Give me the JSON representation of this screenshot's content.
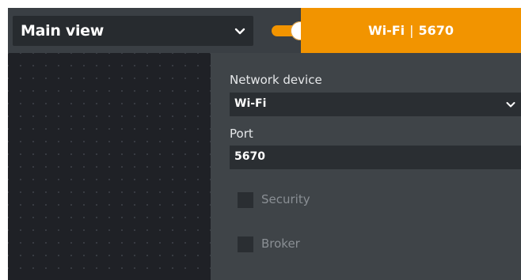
{
  "header": {
    "view_selector": {
      "label": "Main view",
      "icon": "chevron-down-icon"
    },
    "toggle": {
      "state": "on",
      "color": "#f29400"
    },
    "connection_tab": {
      "network": "Wi-Fi",
      "separator": "|",
      "port": "5670",
      "color": "#f29400"
    }
  },
  "form": {
    "network_device": {
      "label": "Network device",
      "value": "Wi-Fi",
      "icon": "chevron-down-icon"
    },
    "port": {
      "label": "Port",
      "value": "5670"
    },
    "security": {
      "label": "Security",
      "checked": false
    },
    "broker": {
      "label": "Broker",
      "checked": false
    }
  }
}
